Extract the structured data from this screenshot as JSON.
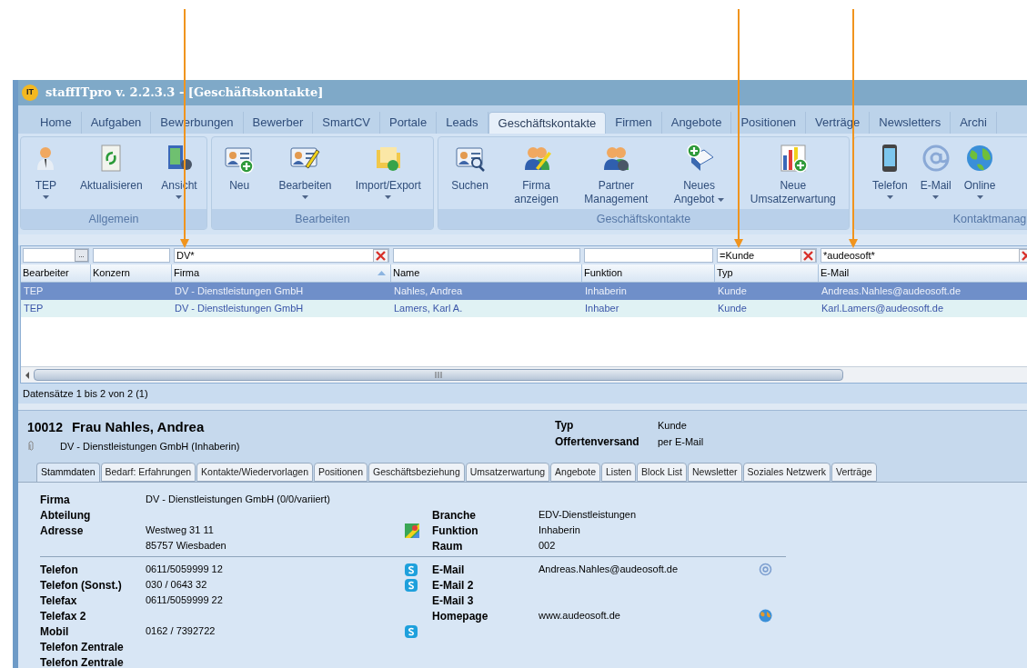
{
  "window": {
    "logo": "IT",
    "title": "staffITpro v. 2.2.3.3 - [Geschäftskontakte]"
  },
  "tabs": [
    {
      "label": "Home",
      "selected": false
    },
    {
      "label": "Aufgaben",
      "selected": false
    },
    {
      "label": "Bewerbungen",
      "selected": false
    },
    {
      "label": "Bewerber",
      "selected": false
    },
    {
      "label": "SmartCV",
      "selected": false
    },
    {
      "label": "Portale",
      "selected": false
    },
    {
      "label": "Leads",
      "selected": false
    },
    {
      "label": "Geschäftskontakte",
      "selected": true
    },
    {
      "label": "Firmen",
      "selected": false
    },
    {
      "label": "Angebote",
      "selected": false
    },
    {
      "label": "Positionen",
      "selected": false
    },
    {
      "label": "Verträge",
      "selected": false
    },
    {
      "label": "Newsletters",
      "selected": false
    },
    {
      "label": "Archi",
      "selected": false
    }
  ],
  "ribbon": {
    "groups": [
      {
        "label": "Allgemein",
        "buttons": [
          {
            "lines": [
              "TEP"
            ],
            "dropdown": true
          },
          {
            "lines": [
              "Aktualisieren"
            ],
            "dropdown": false
          },
          {
            "lines": [
              "Ansicht"
            ],
            "dropdown": true
          }
        ]
      },
      {
        "label": "Bearbeiten",
        "buttons": [
          {
            "lines": [
              "Neu"
            ],
            "dropdown": false
          },
          {
            "lines": [
              "Bearbeiten"
            ],
            "dropdown": true
          },
          {
            "lines": [
              "Import/Export"
            ],
            "dropdown": true
          }
        ]
      },
      {
        "label": "Geschäftskontakte",
        "buttons": [
          {
            "lines": [
              "Suchen"
            ],
            "dropdown": false
          },
          {
            "lines": [
              "Firma",
              "anzeigen"
            ],
            "dropdown": false
          },
          {
            "lines": [
              "Partner",
              "Management"
            ],
            "dropdown": false
          },
          {
            "lines": [
              "Neues",
              "Angebot"
            ],
            "dropdown": true
          },
          {
            "lines": [
              "Neue",
              "Umsatzerwartung"
            ],
            "dropdown": false
          }
        ]
      },
      {
        "label": "Kontaktmanag",
        "buttons": [
          {
            "lines": [
              "Telefon"
            ],
            "dropdown": true
          },
          {
            "lines": [
              "E-Mail"
            ],
            "dropdown": true
          },
          {
            "lines": [
              "Online"
            ],
            "dropdown": true
          }
        ]
      }
    ]
  },
  "grid": {
    "columns": [
      {
        "label": "Bearbeiter",
        "filter": {
          "button": "...",
          "clear": false
        },
        "sort_ascending": false
      },
      {
        "label": "Konzern",
        "filter": {
          "clear": false
        },
        "sort_ascending": false
      },
      {
        "label": "Firma",
        "filter": {
          "value": "DV*",
          "clear": true
        },
        "sort_ascending": true
      },
      {
        "label": "Name",
        "filter": {
          "clear": false
        },
        "sort_ascending": false
      },
      {
        "label": "Funktion",
        "filter": {
          "clear": false
        },
        "sort_ascending": false
      },
      {
        "label": "Typ",
        "filter": {
          "value": "=Kunde",
          "clear": true
        },
        "sort_ascending": false
      },
      {
        "label": "E-Mail",
        "filter": {
          "value": "*audeosoft*",
          "clear": true
        },
        "sort_ascending": false
      }
    ],
    "rows": [
      {
        "selected": true,
        "cells": [
          "TEP",
          null,
          "DV - Dienstleistungen GmbH",
          "Nahles, Andrea",
          "Inhaberin",
          "Kunde",
          "Andreas.Nahles@audeosoft.de"
        ]
      },
      {
        "selected": false,
        "cells": [
          "TEP",
          null,
          "DV - Dienstleistungen GmbH",
          "Lamers, Karl A.",
          "Inhaber",
          "Kunde",
          "Karl.Lamers@audeosoft.de"
        ]
      }
    ],
    "status": "Datensätze 1 bis 2 von 2 (1)"
  },
  "detail": {
    "id": "10012",
    "name": "Frau Nahles, Andrea",
    "company": "DV - Dienstleistungen GmbH (Inhaberin)",
    "info": [
      {
        "label": "Typ",
        "value": "Kunde"
      },
      {
        "label": "Offertenversand",
        "value": "per E-Mail"
      }
    ],
    "tabs": [
      {
        "label": "Stammdaten",
        "selected": true
      },
      {
        "label": "Bedarf: Erfahrungen",
        "selected": false
      },
      {
        "label": "Kontakte/Wiedervorlagen",
        "selected": false
      },
      {
        "label": "Positionen",
        "selected": false
      },
      {
        "label": "Geschäftsbeziehung",
        "selected": false
      },
      {
        "label": "Umsatzerwartung",
        "selected": false
      },
      {
        "label": "Angebote",
        "selected": false
      },
      {
        "label": "Listen",
        "selected": false
      },
      {
        "label": "Block List",
        "selected": false
      },
      {
        "label": "Newsletter",
        "selected": false
      },
      {
        "label": "Soziales Netzwerk",
        "selected": false
      },
      {
        "label": "Verträge",
        "selected": false
      }
    ],
    "sections": [
      {
        "left": [
          {
            "kind": "text",
            "label": "Firma",
            "lines": [
              "DV - Dienstleistungen GmbH (0/0/variiert)"
            ]
          },
          {
            "kind": "text",
            "label": "Abteilung"
          },
          {
            "kind": "address",
            "label": "Adresse",
            "lines": [
              "Westweg 31 11",
              "85757 Wiesbaden"
            ]
          }
        ],
        "right": [
          {
            "kind": "text",
            "label": "Branche",
            "lines": [
              "EDV-Dienstleistungen"
            ]
          },
          {
            "kind": "text",
            "label": "Funktion",
            "lines": [
              "Inhaberin"
            ]
          },
          {
            "kind": "text",
            "label": "Raum",
            "lines": [
              "002"
            ]
          }
        ]
      },
      {
        "left": [
          {
            "kind": "phone",
            "label": "Telefon",
            "lines": [
              "0611/5059999 12"
            ]
          },
          {
            "kind": "phone",
            "label": "Telefon (Sonst.)",
            "lines": [
              "030 / 0643 32"
            ]
          },
          {
            "kind": "text",
            "label": "Telefax",
            "lines": [
              "0611/5059999 22"
            ]
          },
          {
            "kind": "text",
            "label": "Telefax 2"
          },
          {
            "kind": "phone",
            "label": "Mobil",
            "lines": [
              "0162 / 7392722"
            ]
          },
          {
            "kind": "text",
            "label": "Telefon Zentrale"
          },
          {
            "kind": "text",
            "label": "Telefon Zentrale"
          }
        ],
        "right": [
          {
            "kind": "email",
            "label": "E-Mail",
            "lines": [
              "Andreas.Nahles@audeosoft.de"
            ]
          },
          {
            "kind": "text",
            "label": "E-Mail 2"
          },
          {
            "kind": "text",
            "label": "E-Mail 3"
          },
          {
            "kind": "web",
            "label": "Homepage",
            "lines": [
              "www.audeosoft.de"
            ]
          }
        ]
      }
    ]
  }
}
